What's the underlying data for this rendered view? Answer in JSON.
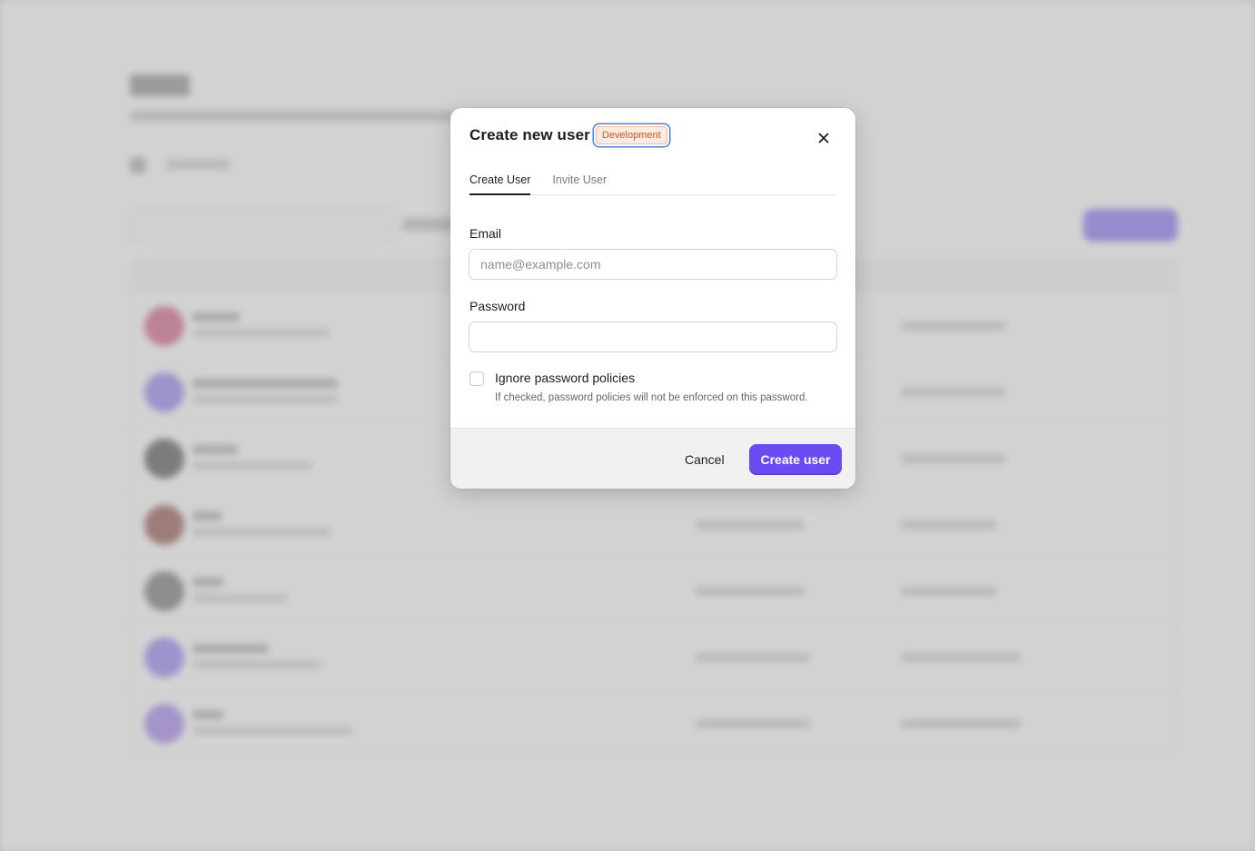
{
  "modal": {
    "title": "Create new user",
    "environment_badge": "Development",
    "close_icon": "close-icon",
    "tabs": [
      {
        "label": "Create User",
        "active": true
      },
      {
        "label": "Invite User",
        "active": false
      }
    ],
    "email": {
      "label": "Email",
      "placeholder": "name@example.com",
      "value": ""
    },
    "password": {
      "label": "Password",
      "value": ""
    },
    "ignore_policies": {
      "label": "Ignore password policies",
      "help": "If checked, password policies will not be enforced on this password.",
      "checked": false
    },
    "cancel_label": "Cancel",
    "submit_label": "Create user"
  },
  "colors": {
    "accent": "#6c4bf2",
    "badge_text": "#d4541d",
    "badge_bg": "#fdebe2",
    "overlay": "#cfcfcf"
  }
}
